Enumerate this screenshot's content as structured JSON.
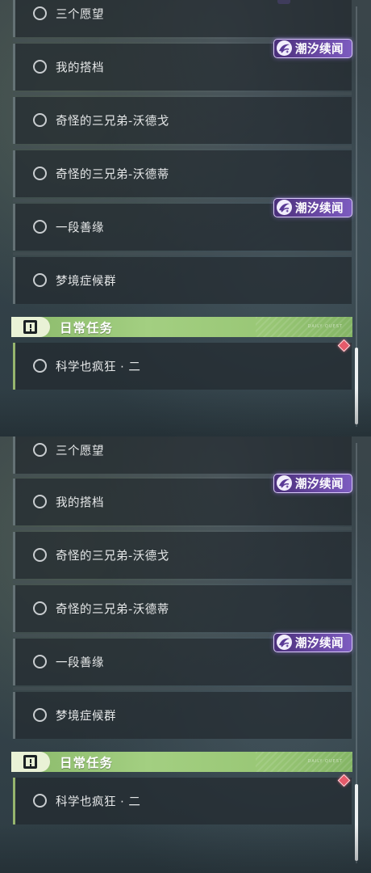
{
  "panels": [
    {
      "quests": [
        {
          "label": "三个愿望"
        },
        {
          "label": "我的搭档"
        },
        {
          "label": "奇怪的三兄弟-沃德戈"
        },
        {
          "label": "奇怪的三兄弟-沃德蒂"
        },
        {
          "label": "一段善缘"
        },
        {
          "label": "梦境症候群"
        }
      ],
      "badges": [
        {
          "label": "潮汐续闻"
        },
        {
          "label": "潮汐续闻"
        }
      ],
      "section": {
        "title": "日常任务",
        "tag": "DAILY QUEST"
      },
      "daily_quests": [
        {
          "label": "科学也疯狂 · 二"
        }
      ]
    },
    {
      "quests": [
        {
          "label": "三个愿望"
        },
        {
          "label": "我的搭档"
        },
        {
          "label": "奇怪的三兄弟-沃德戈"
        },
        {
          "label": "奇怪的三兄弟-沃德蒂"
        },
        {
          "label": "一段善缘"
        },
        {
          "label": "梦境症候群"
        }
      ],
      "badges": [
        {
          "label": "潮汐续闻"
        },
        {
          "label": "潮汐续闻"
        }
      ],
      "section": {
        "title": "日常任务",
        "tag": "DAILY QUEST"
      },
      "daily_quests": [
        {
          "label": "科学也疯狂 · 二"
        }
      ]
    }
  ],
  "colors": {
    "badge": "#6b4aa6",
    "section_header": "#a3cf81",
    "tracked_marker": "#e55a6a"
  }
}
